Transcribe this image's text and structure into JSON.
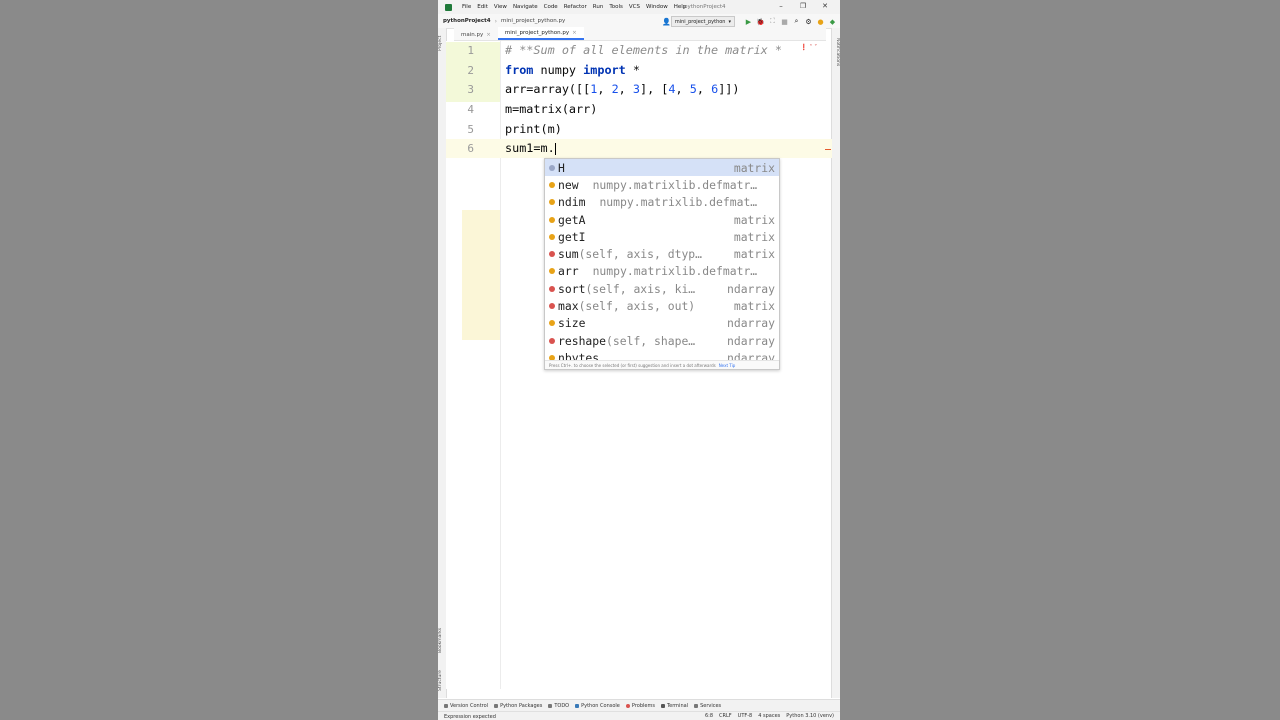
{
  "window": {
    "title": "pythonProject4"
  },
  "menu": [
    "File",
    "Edit",
    "View",
    "Navigate",
    "Code",
    "Refactor",
    "Run",
    "Tools",
    "VCS",
    "Window",
    "Help"
  ],
  "nav": {
    "project": "pythonProject4",
    "file": "mini_project_python.py"
  },
  "run_config": "mini_project_python",
  "tabs": [
    {
      "label": "main.py"
    },
    {
      "label": "mini_project_python.py"
    }
  ],
  "sidebar_left": {
    "project": "Project",
    "bookmarks": "Bookmarks",
    "structure": "Structure"
  },
  "sidebar_right": {
    "notifications": "Notifications"
  },
  "line_numbers": [
    "1",
    "2",
    "3",
    "4",
    "5",
    "6"
  ],
  "code": {
    "l1": "# **Sum of all elements in the matrix *",
    "l2_kw1": "from",
    "l2_mid": " numpy ",
    "l2_kw2": "import",
    "l2_end": " *",
    "l3_a": "arr=array([[",
    "l3_n1": "1",
    "l3_c1": ", ",
    "l3_n2": "2",
    "l3_c2": ", ",
    "l3_n3": "3",
    "l3_b": "], [",
    "l3_n4": "4",
    "l3_c3": ", ",
    "l3_n5": "5",
    "l3_c4": ", ",
    "l3_n6": "6",
    "l3_e": "]])",
    "l4": "m=matrix(arr)",
    "l5": "print(m)",
    "l6": "sum1=m."
  },
  "completion": {
    "items": [
      {
        "name": "H",
        "type": "matrix"
      },
      {
        "name": "new",
        "detail": "numpy.matrixlib.defmatr…"
      },
      {
        "name": "ndim",
        "detail": "numpy.matrixlib.defmat…"
      },
      {
        "name": "getA",
        "type": "matrix"
      },
      {
        "name": "getI",
        "type": "matrix"
      },
      {
        "name": "sum",
        "tail": "(self, axis, dtyp…",
        "type": "matrix"
      },
      {
        "name": "arr",
        "detail": "numpy.matrixlib.defmatr…"
      },
      {
        "name": "sort",
        "tail": "(self, axis, ki…",
        "type": "ndarray"
      },
      {
        "name": "max",
        "tail": "(self, axis, out)",
        "type": "matrix"
      },
      {
        "name": "size",
        "type": "ndarray"
      },
      {
        "name": "reshape",
        "tail": "(self, shape…",
        "type": "ndarray"
      },
      {
        "name": "nbytes",
        "type": "ndarray"
      }
    ],
    "footer": "Press Ctrl+. to choose the selected (or first) suggestion and insert a dot afterwards",
    "footer_link": "Next Tip"
  },
  "toolwindows": [
    "Version Control",
    "Python Packages",
    "TODO",
    "Python Console",
    "Problems",
    "Terminal",
    "Services"
  ],
  "status": {
    "message": "Expression expected",
    "position": "6:8",
    "line_sep": "CRLF",
    "encoding": "UTF-8",
    "indent": "4 spaces",
    "interpreter": "Python 3.10 (venv)"
  },
  "colors": {
    "keyword": "#0033b3",
    "number": "#1750eb",
    "comment": "#8c8c8c",
    "accent": "#3574f0",
    "selection": "#d5e1f7"
  }
}
